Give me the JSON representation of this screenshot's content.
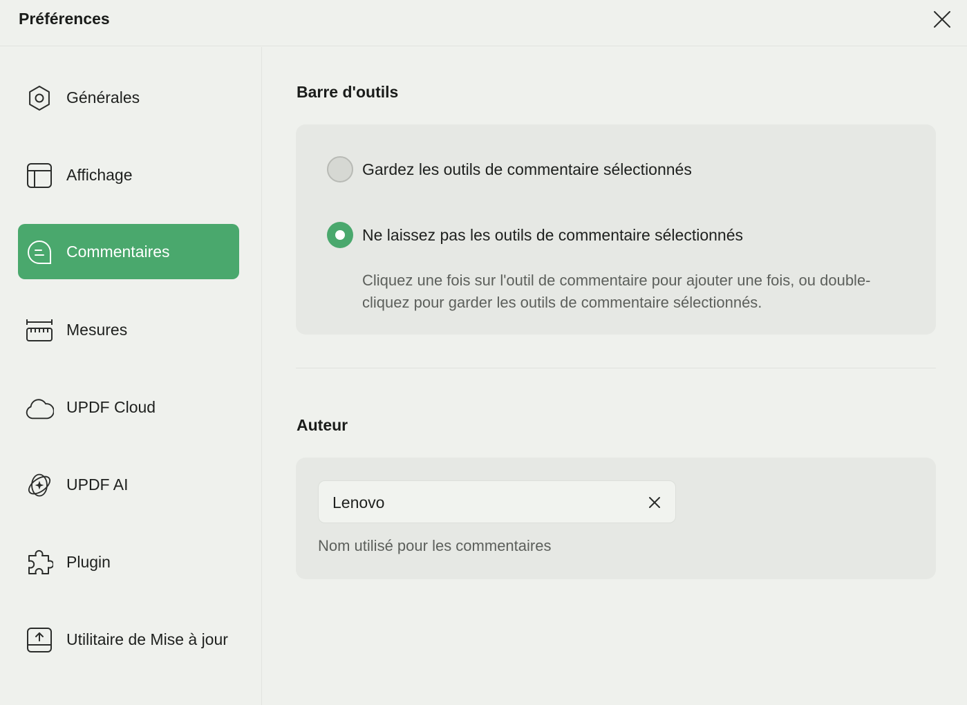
{
  "window": {
    "title": "Préférences"
  },
  "sidebar": {
    "items": [
      {
        "label": "Générales",
        "icon": "gear-icon",
        "active": false
      },
      {
        "label": "Affichage",
        "icon": "layout-icon",
        "active": false
      },
      {
        "label": "Commentaires",
        "icon": "comment-icon",
        "active": true
      },
      {
        "label": "Mesures",
        "icon": "ruler-icon",
        "active": false
      },
      {
        "label": "UPDF Cloud",
        "icon": "cloud-icon",
        "active": false
      },
      {
        "label": "UPDF AI",
        "icon": "ai-sparkle-icon",
        "active": false
      },
      {
        "label": "Plugin",
        "icon": "puzzle-icon",
        "active": false
      },
      {
        "label": "Utilitaire de Mise à jour",
        "icon": "update-icon",
        "active": false
      }
    ]
  },
  "toolbar_section": {
    "title": "Barre d'outils",
    "options": [
      {
        "label": "Gardez les outils de commentaire sélectionnés",
        "selected": false
      },
      {
        "label": "Ne laissez pas les outils de commentaire sélectionnés",
        "selected": true
      }
    ],
    "hint": "Cliquez une fois sur l'outil de commentaire pour ajouter une fois, ou double-cliquez pour garder les outils de commentaire sélectionnés."
  },
  "author_section": {
    "title": "Auteur",
    "value": "Lenovo",
    "hint": "Nom utilisé pour les commentaires"
  },
  "colors": {
    "accent": "#4aa86d",
    "background": "#eff1ed",
    "panel": "#e6e8e4"
  }
}
